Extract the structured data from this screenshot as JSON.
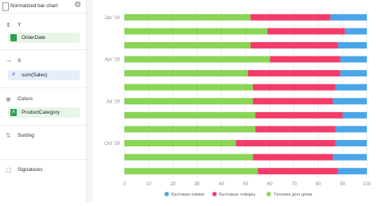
{
  "app": {
    "title": "Normalized bar chart"
  },
  "sidebar": {
    "sections": [
      {
        "label": "Y",
        "icon": "y-axis-icon"
      },
      {
        "label": "X",
        "icon": "x-axis-icon"
      },
      {
        "label": "Colors",
        "icon": "colors-icon"
      },
      {
        "label": "Sorting",
        "icon": "sorting-icon"
      },
      {
        "label": "Signatures",
        "icon": "signatures-icon"
      }
    ],
    "fields": {
      "y": {
        "tag": "",
        "label": "OrderDate",
        "color": "#2e9e4f"
      },
      "x": {
        "tag": "#",
        "label": "sum(Sales)",
        "color": "#4d7fd6"
      },
      "colors": {
        "tag": "A",
        "label": "ProductCategory",
        "color": "#2e9e4f"
      }
    }
  },
  "chart_data": {
    "type": "bar",
    "orientation": "horizontal",
    "stacked": true,
    "normalized": true,
    "y_tick_labels": [
      "Jan '19",
      "Apr '19",
      "Jul '19",
      "Oct '19"
    ],
    "x_ticks": [
      0,
      10,
      20,
      30,
      40,
      50,
      60,
      70,
      80,
      90,
      100
    ],
    "xlim": [
      0,
      100
    ],
    "grid": "vertical",
    "legend_position": "bottom",
    "series": [
      {
        "name": "Техника для дома",
        "color": "#8ad554",
        "values": [
          52,
          59,
          52,
          60,
          51,
          53,
          53,
          54,
          54,
          46,
          53,
          55
        ]
      },
      {
        "name": "Бытовые товары",
        "color": "#f23c6a",
        "values": [
          33,
          32,
          36,
          29,
          38,
          34,
          33,
          36,
          33,
          41,
          33,
          33
        ]
      },
      {
        "name": "Бытовая химия",
        "color": "#4aa5e9",
        "values": [
          15,
          9,
          12,
          11,
          11,
          13,
          14,
          10,
          13,
          13,
          14,
          12
        ]
      }
    ],
    "legend_order": [
      "Бытовая химия",
      "Бытовые товары",
      "Техника для дома"
    ]
  }
}
